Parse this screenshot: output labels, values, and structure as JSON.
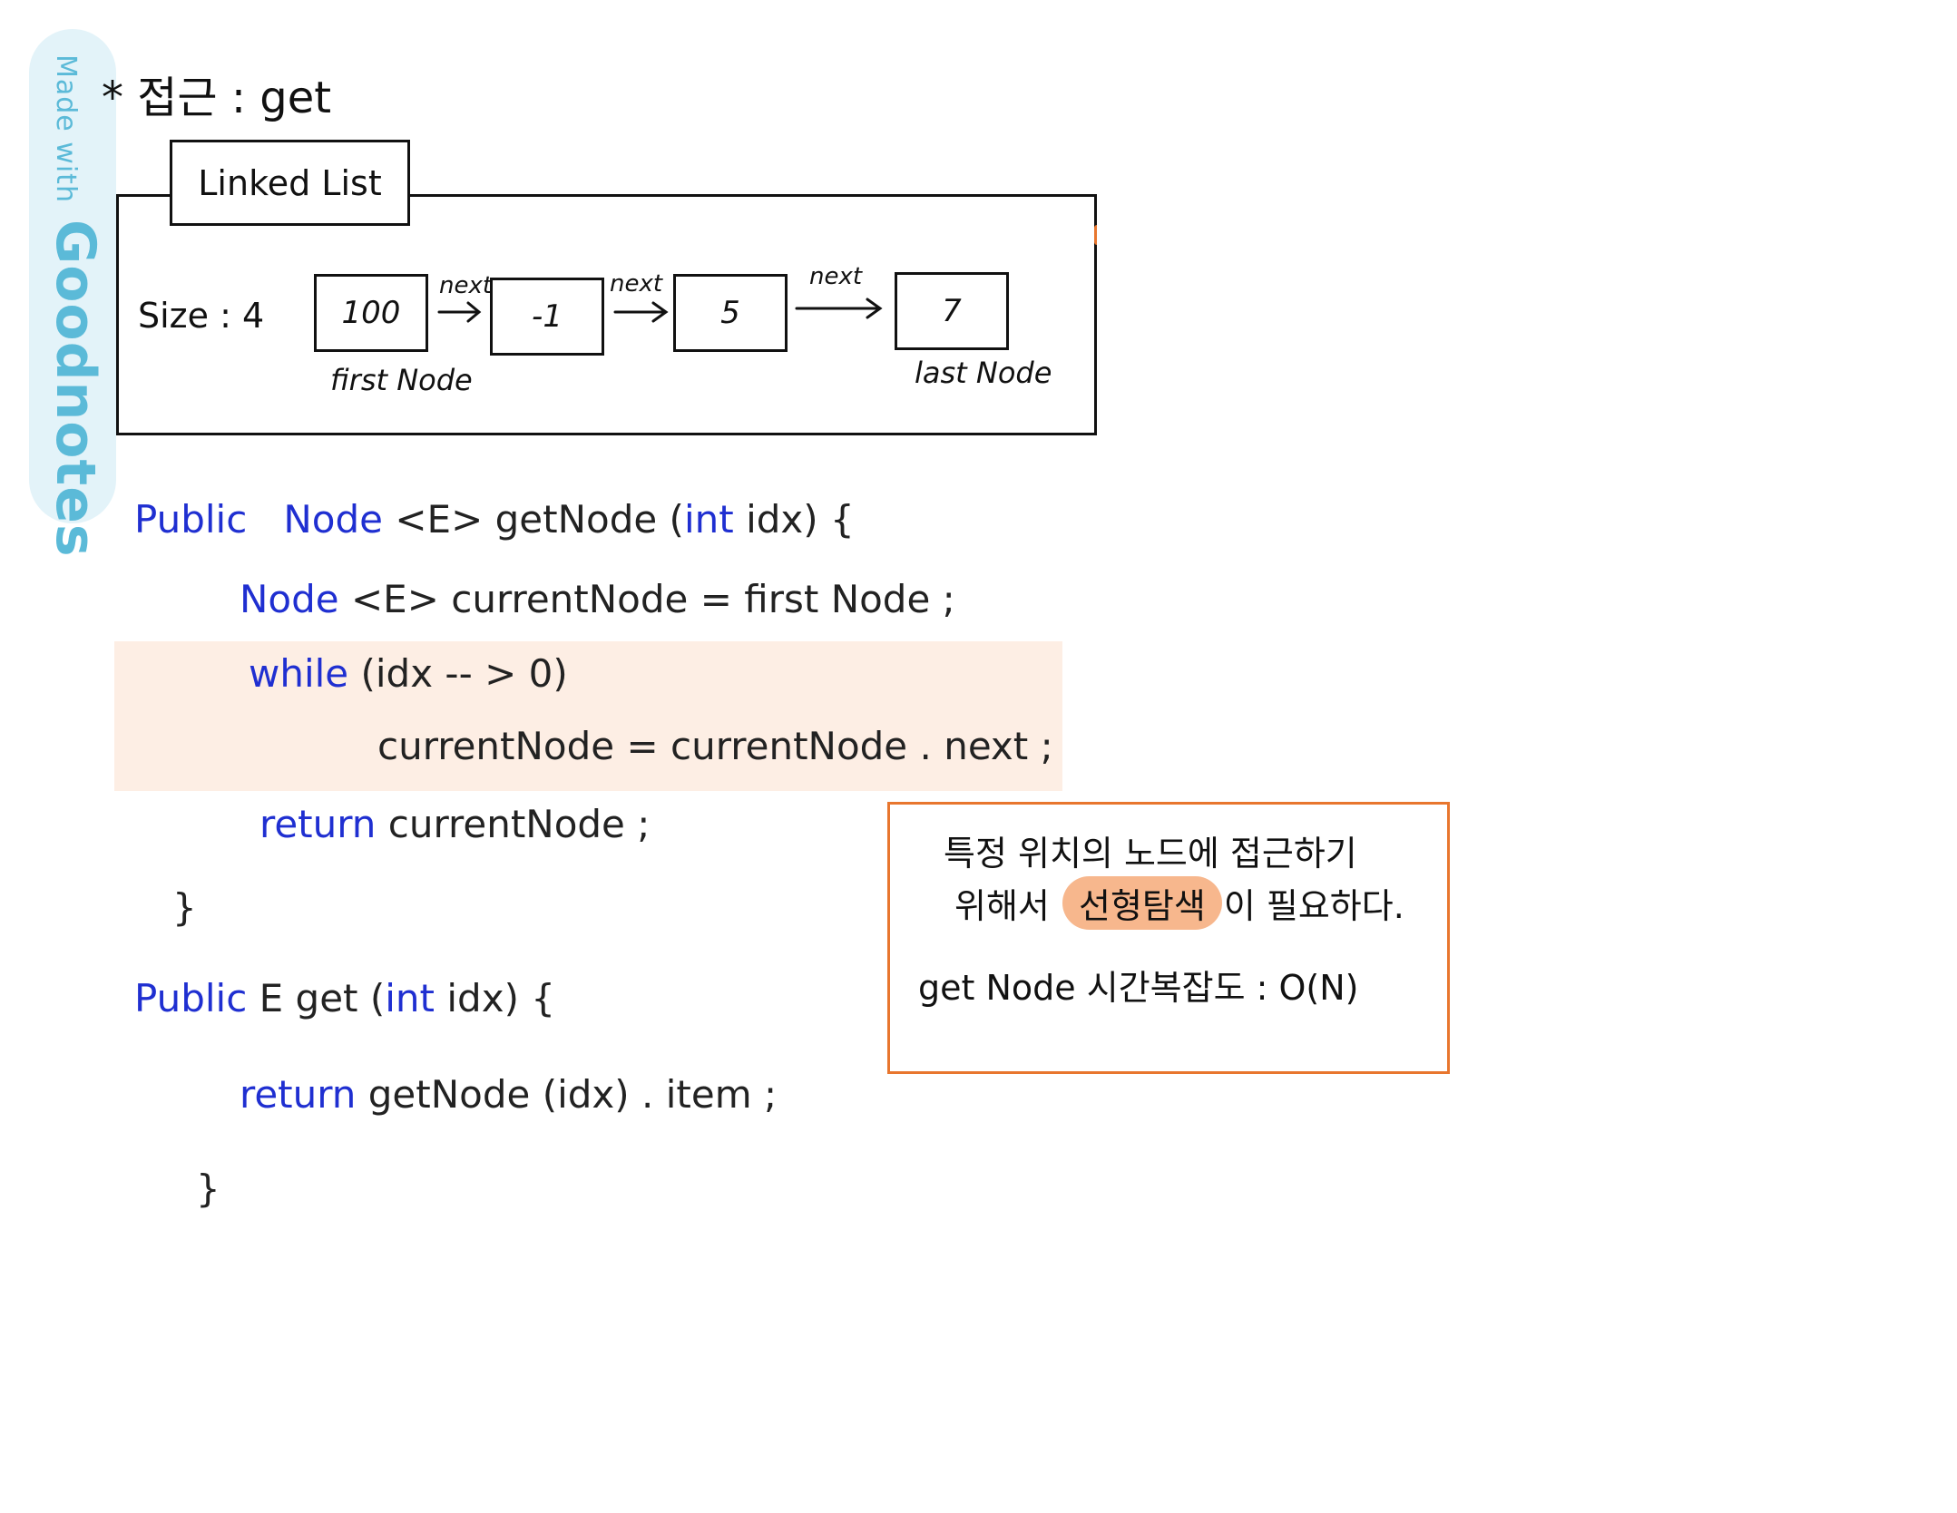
{
  "watermark": {
    "prefix": "Made with",
    "brand": "Goodnotes"
  },
  "title": "* 접근 : get",
  "linked_list": {
    "label": "Linked List",
    "size_label": "Size : 4",
    "nodes": [
      "100",
      "-1",
      "5",
      "7"
    ],
    "next_labels": [
      "next",
      "next",
      "next"
    ],
    "first_label": "first Node",
    "last_label": "last Node"
  },
  "code": {
    "line1": {
      "kw1": "Public",
      "kw2": "Node",
      "rest1": " <E> getNode (",
      "kw3": "int",
      "rest2": " idx) {"
    },
    "line2": {
      "kw": "Node",
      "rest": " <E>  currentNode = first Node ;"
    },
    "line3": {
      "kw": "while",
      "rest": " (idx -- > 0)"
    },
    "line4": "currentNode = currentNode . next ;",
    "line5": {
      "kw": "return",
      "rest": " currentNode ;"
    },
    "line6": "}",
    "line7": {
      "kw": "Public",
      "rest1": " E  get (",
      "kw2": "int",
      "rest2": "  idx) {"
    },
    "line8": {
      "kw": "return",
      "rest": "  getNode (idx) . item ;"
    },
    "line9": "}"
  },
  "note": {
    "line1": "특정 위치의 노드에 접근하기",
    "line2_pre": "위해서",
    "line2_highlight": "선형탐색",
    "line2_post": "이 필요하다.",
    "line3": "get Node  시간복잡도 : O(N)"
  },
  "colors": {
    "keyword": "#1f2fd1",
    "accent": "#e8762e",
    "highlight_band": "#fdeee4",
    "watermark": "#5bbad8"
  }
}
